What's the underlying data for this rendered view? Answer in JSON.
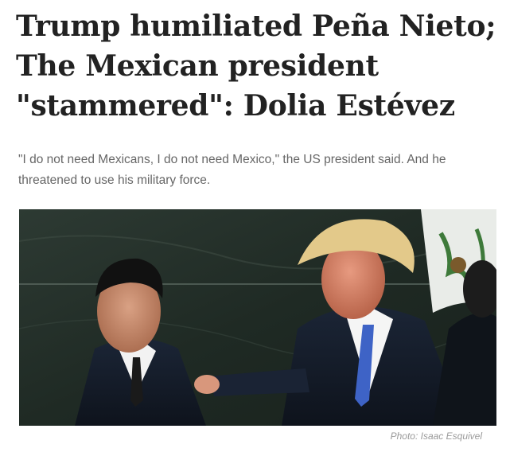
{
  "article": {
    "headline_lines": [
      "Trump humiliated Peña Nieto;",
      "The Mexican president",
      "\"stammered\": Dolia Estévez"
    ],
    "dek": "\"I do not need Mexicans, I do not need Mexico,\" the US president said. And he threatened to use his military force.",
    "photo_caption": "Photo: Isaac Esquivel"
  }
}
